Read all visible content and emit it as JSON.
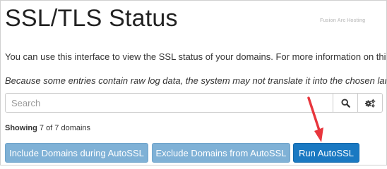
{
  "page": {
    "title": "SSL/TLS Status",
    "watermark": "Fusion Arc Hosting",
    "description": "You can use this interface to view the SSL status of your domains. For more information on this in",
    "note": "Because some entries contain raw log data, the system may not translate it into the chosen language or"
  },
  "search": {
    "placeholder": "Search",
    "search_icon": "search-icon",
    "settings_icon": "gears-icon"
  },
  "status": {
    "showing_label": "Showing",
    "showing_count": "7 of 7 domains"
  },
  "actions": {
    "include_label": "Include Domains during AutoSSL",
    "exclude_label": "Exclude Domains from AutoSSL",
    "run_label": "Run AutoSSL"
  },
  "colors": {
    "accent": "#1a79c2",
    "button_light": "#7fb1d6",
    "arrow": "#e8363d"
  }
}
